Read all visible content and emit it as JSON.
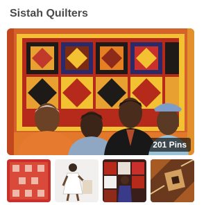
{
  "board": {
    "title": "Sistah Quilters",
    "pin_count_label": "201 Pins"
  },
  "colors": {
    "title_text": "#4a4a4a",
    "quilt_orange": "#e2782a",
    "quilt_gold": "#f2c233",
    "quilt_red": "#b52a1a",
    "quilt_black": "#1e1a18"
  },
  "thumbnails": [
    {
      "subject": "red-quilt"
    },
    {
      "subject": "white-dress-figure"
    },
    {
      "subject": "person-with-quilts"
    },
    {
      "subject": "brown-quilt"
    }
  ]
}
